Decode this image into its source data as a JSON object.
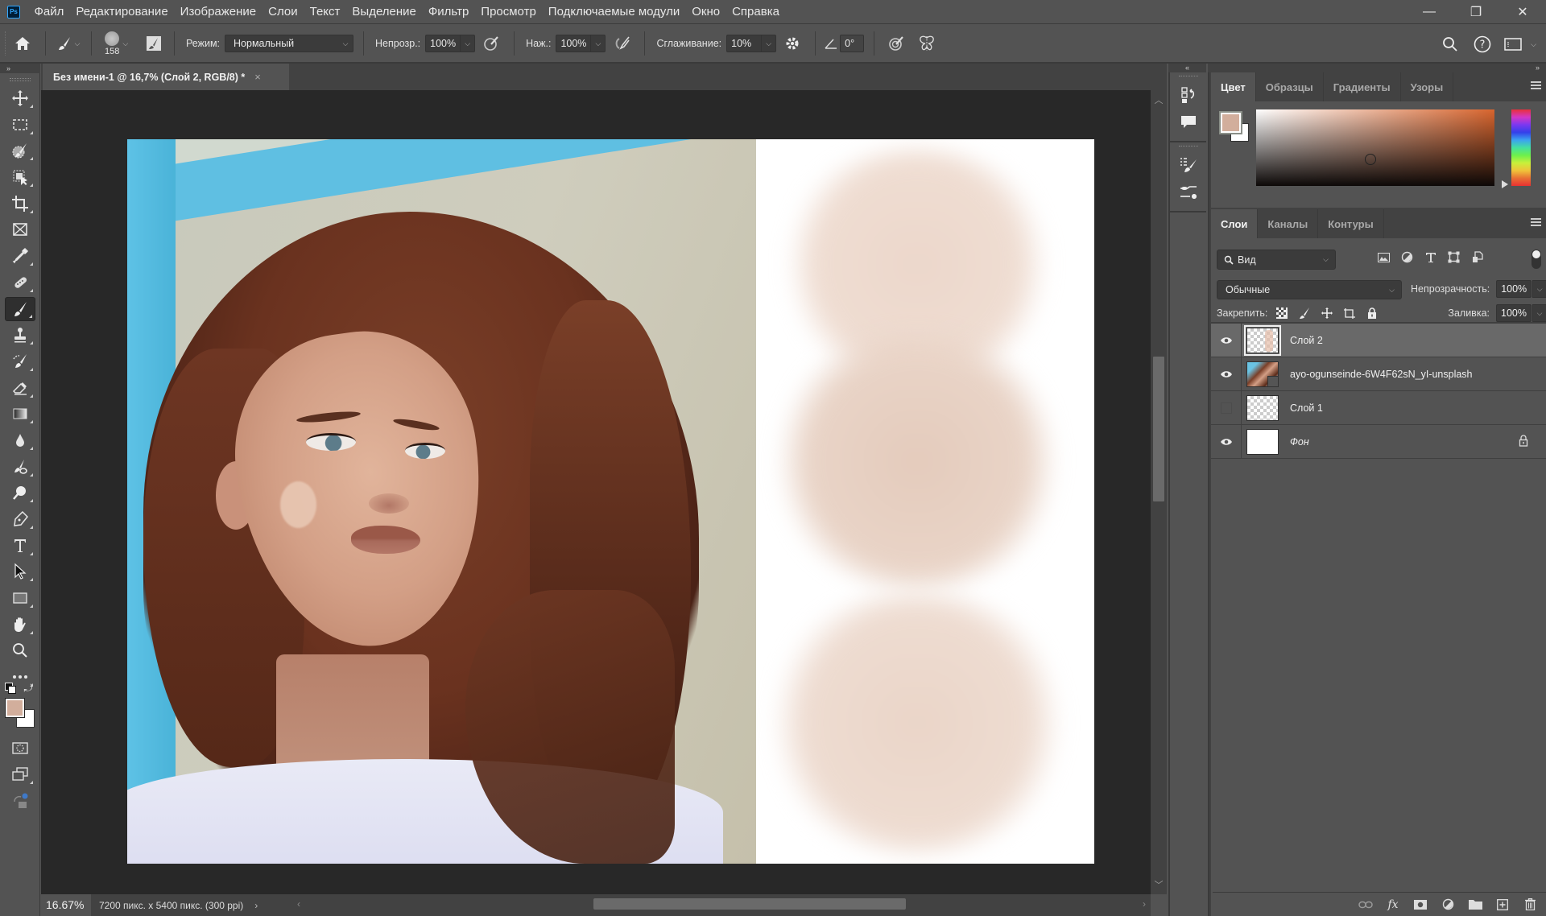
{
  "app": {
    "logo": "Ps",
    "menu": [
      "Файл",
      "Редактирование",
      "Изображение",
      "Слои",
      "Текст",
      "Выделение",
      "Фильтр",
      "Просмотр",
      "Подключаемые модули",
      "Окно",
      "Справка"
    ],
    "window_controls": {
      "minimize": "—",
      "restore": "❐",
      "close": "✕"
    }
  },
  "options_bar": {
    "brush_size": "158",
    "mode_label": "Режим:",
    "mode_value": "Нормальный",
    "opacity_label": "Непрозр.:",
    "opacity_value": "100%",
    "flow_label": "Наж.:",
    "flow_value": "100%",
    "smoothing_label": "Сглаживание:",
    "smoothing_value": "10%",
    "angle_value": "0°"
  },
  "toolbar": {
    "tools": [
      "move",
      "rect-marquee",
      "quick-selection",
      "object-selection",
      "crop",
      "frame",
      "eyedropper",
      "healing-brush",
      "brush",
      "clone-stamp",
      "history-brush",
      "eraser",
      "gradient",
      "blur",
      "dodge-burn",
      "sponge",
      "pen",
      "type",
      "path-selection",
      "rectangle",
      "hand",
      "zoom",
      "more"
    ],
    "active_tool": "brush",
    "foreground_color": "#d2ae9c",
    "background_color": "#ffffff"
  },
  "document": {
    "tab_title": "Без имени-1 @ 16,7% (Слой 2, RGB/8) *",
    "close": "×",
    "zoom": "16.67%",
    "info": "7200 пикс. x 5400 пикс. (300 ppi)",
    "info_arrow": "›",
    "scroll_left": "‹",
    "scroll_right": "›",
    "scroll_up": "︿",
    "scroll_down": "﹀"
  },
  "color_panel": {
    "tabs": [
      "Цвет",
      "Образцы",
      "Градиенты",
      "Узоры"
    ],
    "active_tab": "Цвет",
    "foreground": "#d2ae9c",
    "background": "#ffffff"
  },
  "layers_panel": {
    "tabs": [
      "Слои",
      "Каналы",
      "Контуры"
    ],
    "active_tab": "Слои",
    "filter_placeholder": "Вид",
    "blend_mode": "Обычные",
    "opacity_label": "Непрозрачность:",
    "opacity_value": "100%",
    "lock_label": "Закрепить:",
    "fill_label": "Заливка:",
    "fill_value": "100%",
    "layers": [
      {
        "name": "Слой 2",
        "visible": true,
        "selected": true,
        "locked": false
      },
      {
        "name": "ayo-ogunseinde-6W4F62sN_yI-unsplash",
        "visible": true,
        "selected": false,
        "locked": false
      },
      {
        "name": "Слой 1",
        "visible": false,
        "selected": false,
        "locked": false
      },
      {
        "name": "Фон",
        "visible": true,
        "selected": false,
        "locked": true
      }
    ]
  },
  "panel_collapse": {
    "left": "»",
    "right_collapse": "«",
    "right_expand": "»"
  }
}
